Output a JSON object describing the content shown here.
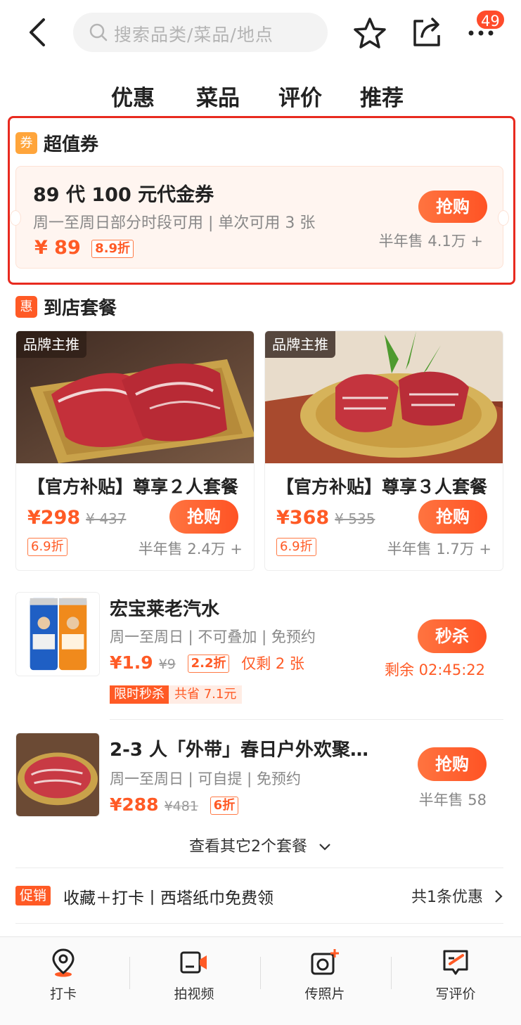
{
  "header": {
    "search_placeholder": "搜索品类/菜品/地点",
    "badge_count": "49",
    "icons": [
      "back-icon",
      "search-icon",
      "star-icon",
      "share-icon",
      "more-icon"
    ]
  },
  "tabs": [
    {
      "label": "优惠",
      "active": true
    },
    {
      "label": "菜品",
      "active": false
    },
    {
      "label": "评价",
      "active": false
    },
    {
      "label": "推荐",
      "active": false
    }
  ],
  "voucher_section": {
    "tag": "券",
    "title": "超值券",
    "card": {
      "title": "89 代 100 元代金券",
      "desc": "周一至周日部分时段可用 | 单次可用 3 张",
      "price": "¥ 89",
      "discount": "8.9折",
      "button": "抢购",
      "sold": "半年售 4.1万 +"
    }
  },
  "meal_section": {
    "tag": "惠",
    "title": "到店套餐",
    "cards": [
      {
        "brand_tag": "品牌主推",
        "title": "【官方补贴】尊享２人套餐",
        "price": "¥298",
        "orig": "¥ 437",
        "discount": "6.9折",
        "button": "抢购",
        "sold": "半年售 2.4万 +"
      },
      {
        "brand_tag": "品牌主推",
        "title": "【官方补贴】尊享３人套餐",
        "price": "¥368",
        "orig": "¥ 535",
        "discount": "6.9折",
        "button": "抢购",
        "sold": "半年售 1.7万 +"
      }
    ],
    "items": [
      {
        "title": "宏宝莱老汽水",
        "desc": "周一至周日 | 不可叠加 | 免预约",
        "price": "¥1.9",
        "orig": "¥9",
        "discount": "2.2折",
        "limit": "仅剩 2 张",
        "flash_label": "限时秒杀",
        "flash_save": "共省 7.1元",
        "button": "秒杀",
        "countdown": "剩余 02:45:22"
      },
      {
        "title": "2-3 人「外带」春日户外欢聚…",
        "desc": "周一至周日 | 可自提 | 免预约",
        "price": "¥288",
        "orig": "¥481",
        "discount": "6折",
        "button": "抢购",
        "sold": "半年售 58"
      }
    ],
    "more": "查看其它2个套餐"
  },
  "promo": {
    "tag": "促销",
    "text": "收藏＋打卡丨西塔纸巾免费领",
    "right": "共1条优惠"
  },
  "bottom_bar": [
    {
      "label": "打卡",
      "icon": "location-pin-icon"
    },
    {
      "label": "拍视频",
      "icon": "video-camera-icon"
    },
    {
      "label": "传照片",
      "icon": "add-photo-icon"
    },
    {
      "label": "写评价",
      "icon": "write-review-icon"
    }
  ],
  "colors": {
    "accent": "#ff5a25",
    "highlight_border": "#e82a1f",
    "voucher_tag": "#ffa53b"
  }
}
